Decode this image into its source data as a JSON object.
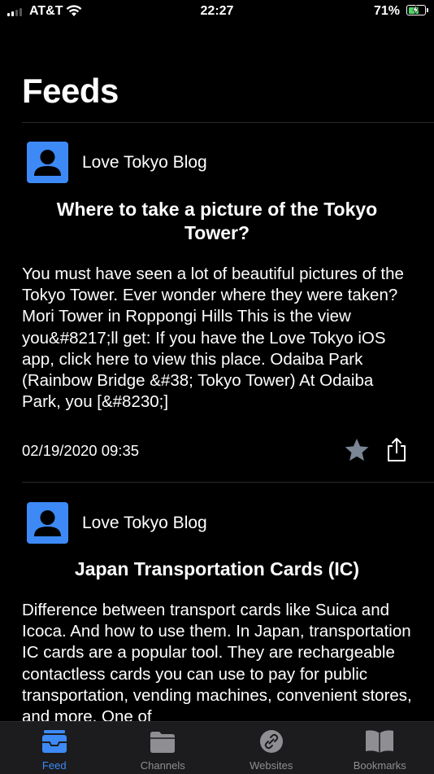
{
  "status_bar": {
    "carrier": "AT&T",
    "time": "22:27",
    "battery_percent": "71%",
    "battery_level": 0.71
  },
  "header": {
    "title": "Feeds"
  },
  "feeds": [
    {
      "source": "Love Tokyo Blog",
      "title": "Where to take a picture of the Tokyo Tower?",
      "body": "You must have seen a lot of beautiful pictures of the Tokyo Tower. Ever wonder where they were taken? Mori Tower in Roppongi Hills This is the view you&#8217;ll get: If you have the Love Tokyo iOS app, click here to view this place. Odaiba Park (Rainbow Bridge &#38; Tokyo Tower) At Odaiba Park, you [&#8230;]",
      "date": "02/19/2020 09:35",
      "favorite_icon": "star-icon",
      "share_icon": "share-icon"
    },
    {
      "source": "Love Tokyo Blog",
      "title": "Japan Transportation Cards (IC)",
      "body": "Difference between transport cards like Suica and Icoca. And how to use them. In Japan, transportation IC cards are a popular tool. They are rechargeable contactless cards you can use to pay for public transportation, vending machines, convenient stores, and more. One of"
    }
  ],
  "tab_bar": {
    "tabs": [
      {
        "label": "Feed",
        "icon": "inbox-icon",
        "active": true
      },
      {
        "label": "Channels",
        "icon": "folder-icon",
        "active": false
      },
      {
        "label": "Websites",
        "icon": "link-icon",
        "active": false
      },
      {
        "label": "Bookmarks",
        "icon": "book-icon",
        "active": false
      }
    ]
  },
  "colors": {
    "accent": "#3d8af7",
    "background": "#000000",
    "tab_bar": "#1c1c1e",
    "inactive": "#8e8e93",
    "battery": "#4cd964"
  }
}
